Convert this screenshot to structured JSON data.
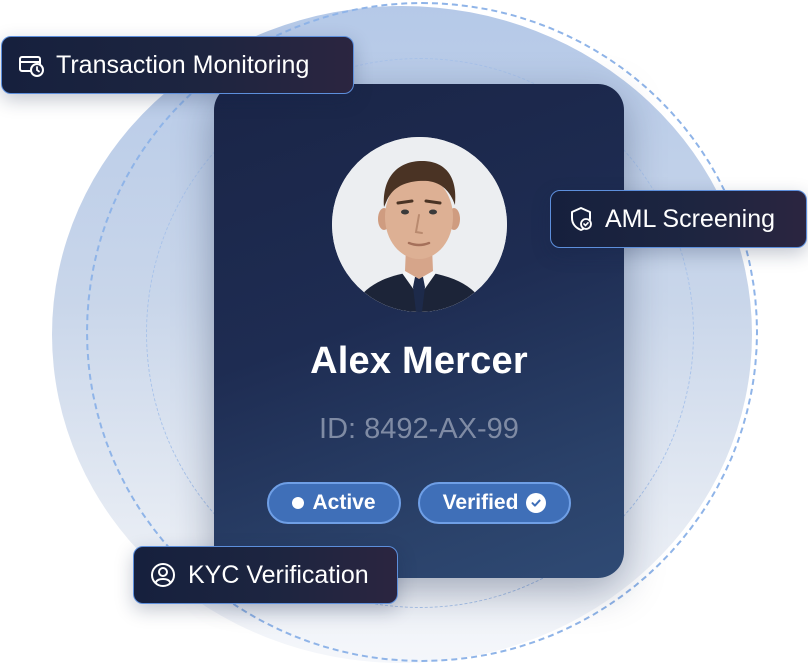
{
  "profile": {
    "name": "Alex Mercer",
    "id_text": "ID: 8492-AX-99",
    "badges": {
      "active": "Active",
      "verified": "Verified"
    }
  },
  "tags": {
    "transaction_monitoring": "Transaction Monitoring",
    "aml_screening": "AML Screening",
    "kyc_verification": "KYC Verification"
  },
  "icons": {
    "transaction_monitoring": "card-clock-icon",
    "aml_screening": "shield-check-icon",
    "kyc_verification": "user-circle-icon",
    "active": "status-dot-icon",
    "verified": "check-circle-icon"
  },
  "colors": {
    "card": "#1e2c52",
    "badge": "#3f6fb8",
    "badge_border": "#6f9fe6",
    "tag_border": "#5d8fdc",
    "id_text": "#7f8ba4"
  }
}
